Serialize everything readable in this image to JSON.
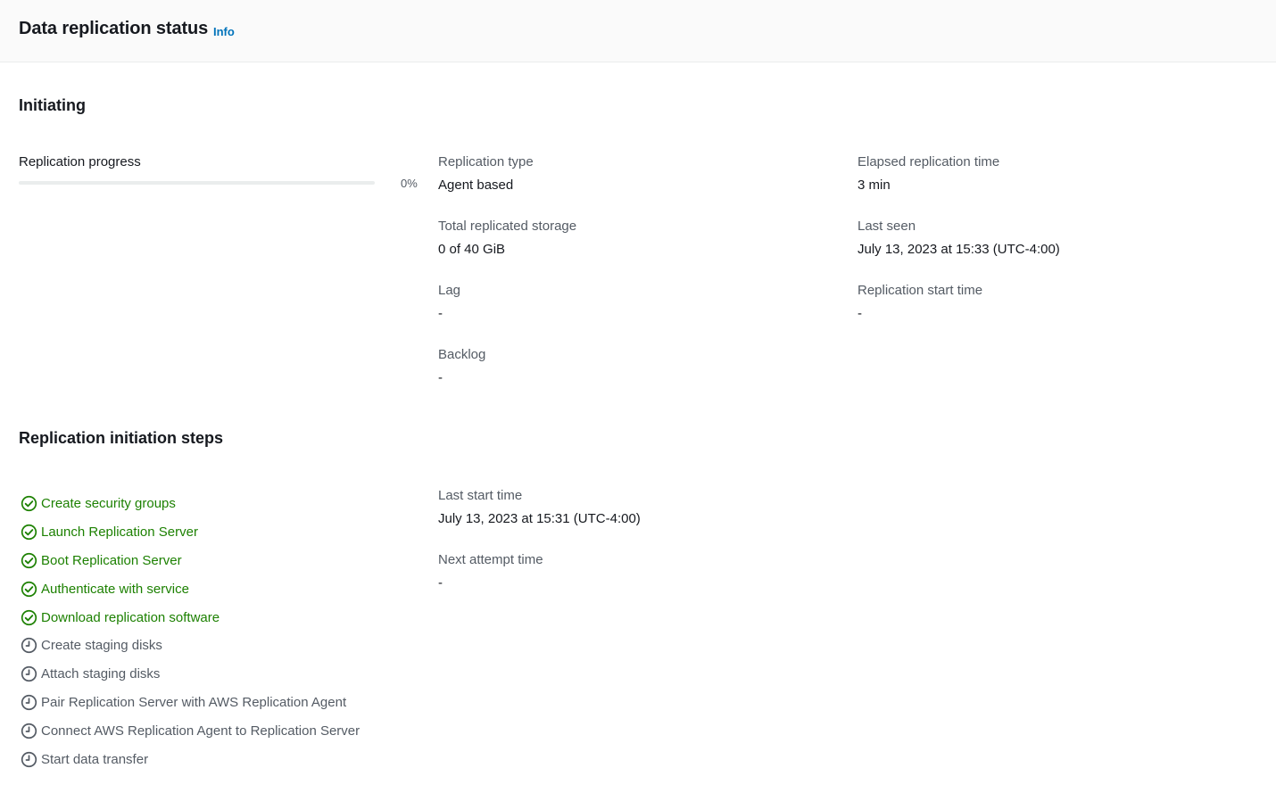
{
  "header": {
    "title": "Data replication status",
    "info_label": "Info"
  },
  "status": {
    "title": "Initiating"
  },
  "progress": {
    "label": "Replication progress",
    "percent": 0,
    "percent_label": "0%",
    "color": "#0073bb"
  },
  "details": {
    "replication_type": {
      "label": "Replication type",
      "value": "Agent based"
    },
    "total_storage": {
      "label": "Total replicated storage",
      "value": "0 of 40 GiB"
    },
    "lag": {
      "label": "Lag",
      "value": "-"
    },
    "backlog": {
      "label": "Backlog",
      "value": "-"
    },
    "elapsed_time": {
      "label": "Elapsed replication time",
      "value": "3 min"
    },
    "last_seen": {
      "label": "Last seen",
      "value": "July 13, 2023 at 15:33 (UTC-4:00)"
    },
    "start_time": {
      "label": "Replication start time",
      "value": "-"
    }
  },
  "steps_section": {
    "title": "Replication initiation steps",
    "last_start": {
      "label": "Last start time",
      "value": "July 13, 2023 at 15:31 (UTC-4:00)"
    },
    "next_attempt": {
      "label": "Next attempt time",
      "value": "-"
    },
    "steps": [
      {
        "label": "Create security groups",
        "status": "done",
        "icon": "check-circle-icon"
      },
      {
        "label": "Launch Replication Server",
        "status": "done",
        "icon": "check-circle-icon"
      },
      {
        "label": "Boot Replication Server",
        "status": "done",
        "icon": "check-circle-icon"
      },
      {
        "label": "Authenticate with service",
        "status": "done",
        "icon": "check-circle-icon"
      },
      {
        "label": "Download replication software",
        "status": "done",
        "icon": "check-circle-icon"
      },
      {
        "label": "Create staging disks",
        "status": "pending",
        "icon": "clock-icon"
      },
      {
        "label": "Attach staging disks",
        "status": "pending",
        "icon": "clock-icon"
      },
      {
        "label": "Pair Replication Server with AWS Replication Agent",
        "status": "pending",
        "icon": "clock-icon"
      },
      {
        "label": "Connect AWS Replication Agent to Replication Server",
        "status": "pending",
        "icon": "clock-icon"
      },
      {
        "label": "Start data transfer",
        "status": "pending",
        "icon": "clock-icon"
      }
    ]
  },
  "colors": {
    "success": "#1d8102",
    "pending": "#545b64",
    "link": "#0073bb"
  }
}
